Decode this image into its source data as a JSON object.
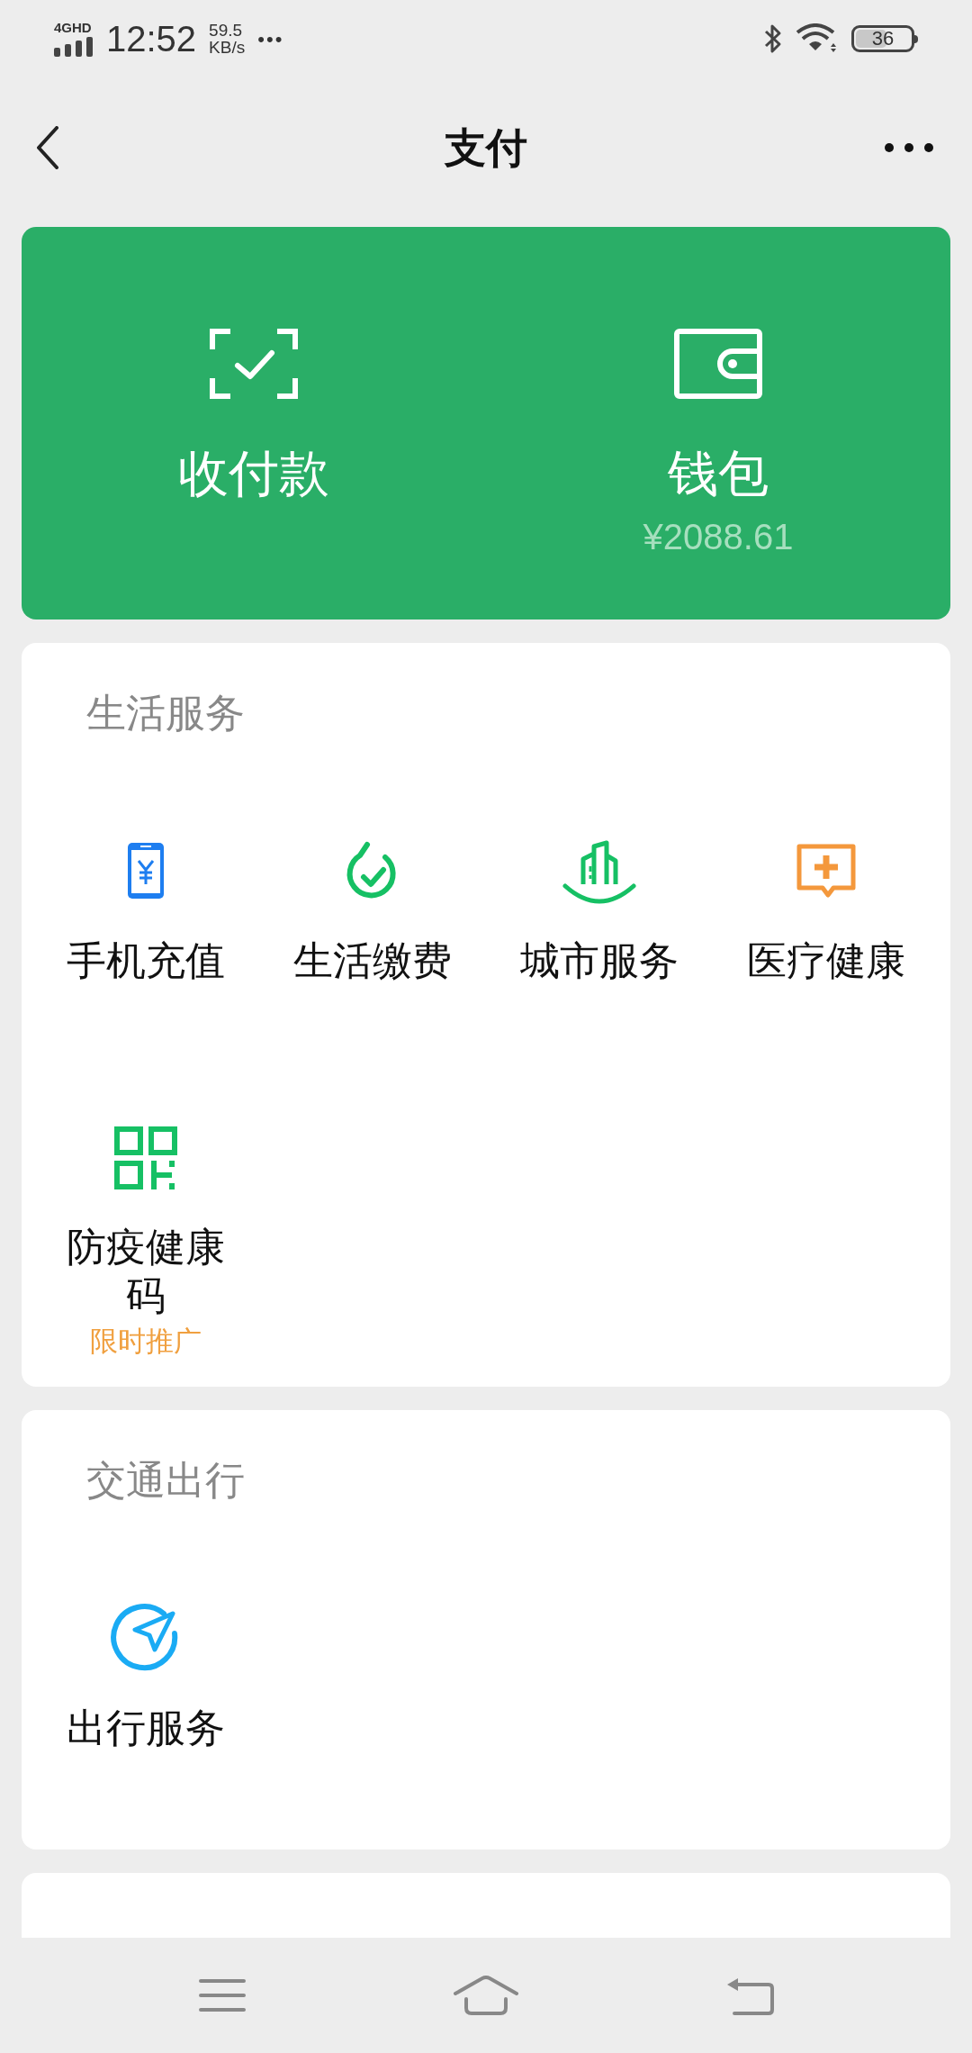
{
  "status_bar": {
    "network": "4GHD",
    "time": "12:52",
    "speed_value": "59.5",
    "speed_unit": "KB/s",
    "more": "•••",
    "battery": "36"
  },
  "nav": {
    "title": "支付"
  },
  "header_card": {
    "actions": [
      {
        "kind": "scan",
        "label": "收付款"
      },
      {
        "kind": "wallet",
        "label": "钱包",
        "amount": "¥2088.61"
      }
    ]
  },
  "sections": [
    {
      "title": "生活服务",
      "items": [
        {
          "kind": "phone",
          "label": "手机充值"
        },
        {
          "kind": "bill",
          "label": "生活缴费"
        },
        {
          "kind": "city",
          "label": "城市服务"
        },
        {
          "kind": "medical",
          "label": "医疗健康"
        },
        {
          "kind": "qr",
          "label": "防疫健康码",
          "tag": "限时推广"
        }
      ]
    },
    {
      "title": "交通出行",
      "items": [
        {
          "kind": "navigation",
          "label": "出行服务"
        }
      ]
    }
  ]
}
